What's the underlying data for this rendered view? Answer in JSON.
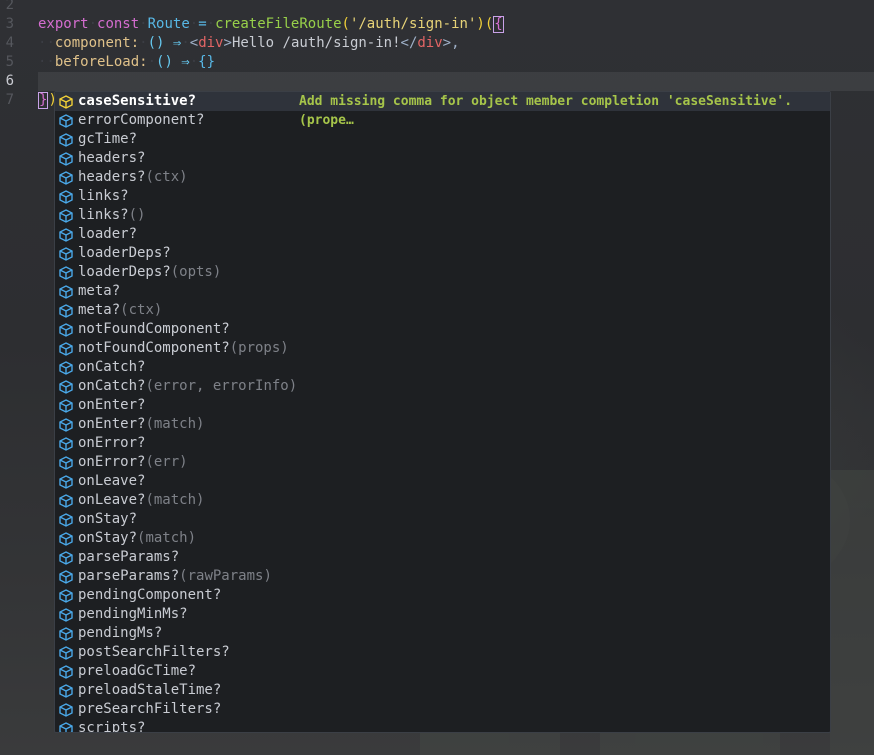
{
  "editor": {
    "line_numbers": [
      "2",
      "3",
      "4",
      "5",
      "6",
      "7"
    ],
    "code": {
      "l3": {
        "export": "export",
        "const": "const",
        "route": "Route",
        "eq": "=",
        "fn": "createFileRoute",
        "open": "(",
        "str": "'/auth/sign-in'",
        "close": ")",
        "paren": "(",
        "brace": "{"
      },
      "l4": {
        "prop": "component:",
        "arrow": "() ⇒",
        "lt": "<",
        "tag": "div",
        "gt": ">",
        "text": "Hello /auth/sign-in!",
        "lt2": "</",
        "tag2": "div",
        "gt2": ">,",
        "dots1": "·",
        "dots2": "·"
      },
      "l5": {
        "prop": "beforeLoad:",
        "arrow": "() ⇒",
        "body": "{}"
      },
      "l7": {
        "brace": "}",
        "paren": ")"
      }
    }
  },
  "completion": {
    "selected_doc": "Add missing comma for object member completion 'caseSensitive'.(prope…",
    "items": [
      {
        "label": "caseSensitive?",
        "detail": ""
      },
      {
        "label": "errorComponent?",
        "detail": ""
      },
      {
        "label": "gcTime?",
        "detail": ""
      },
      {
        "label": "headers?",
        "detail": ""
      },
      {
        "label": "headers?",
        "detail": "(ctx)"
      },
      {
        "label": "links?",
        "detail": ""
      },
      {
        "label": "links?",
        "detail": "()"
      },
      {
        "label": "loader?",
        "detail": ""
      },
      {
        "label": "loaderDeps?",
        "detail": ""
      },
      {
        "label": "loaderDeps?",
        "detail": "(opts)"
      },
      {
        "label": "meta?",
        "detail": ""
      },
      {
        "label": "meta?",
        "detail": "(ctx)"
      },
      {
        "label": "notFoundComponent?",
        "detail": ""
      },
      {
        "label": "notFoundComponent?",
        "detail": "(props)"
      },
      {
        "label": "onCatch?",
        "detail": ""
      },
      {
        "label": "onCatch?",
        "detail": "(error, errorInfo)"
      },
      {
        "label": "onEnter?",
        "detail": ""
      },
      {
        "label": "onEnter?",
        "detail": "(match)"
      },
      {
        "label": "onError?",
        "detail": ""
      },
      {
        "label": "onError?",
        "detail": "(err)"
      },
      {
        "label": "onLeave?",
        "detail": ""
      },
      {
        "label": "onLeave?",
        "detail": "(match)"
      },
      {
        "label": "onStay?",
        "detail": ""
      },
      {
        "label": "onStay?",
        "detail": "(match)"
      },
      {
        "label": "parseParams?",
        "detail": ""
      },
      {
        "label": "parseParams?",
        "detail": "(rawParams)"
      },
      {
        "label": "pendingComponent?",
        "detail": ""
      },
      {
        "label": "pendingMinMs?",
        "detail": ""
      },
      {
        "label": "pendingMs?",
        "detail": ""
      },
      {
        "label": "postSearchFilters?",
        "detail": ""
      },
      {
        "label": "preloadGcTime?",
        "detail": ""
      },
      {
        "label": "preloadStaleTime?",
        "detail": ""
      },
      {
        "label": "preSearchFilters?",
        "detail": ""
      },
      {
        "label": "scripts?",
        "detail": ""
      }
    ],
    "icon": "property-cube-icon",
    "colors": {
      "icon": "#4aa8e8",
      "selected_icon": "#f1d038",
      "doc": "#a6c54a"
    }
  }
}
